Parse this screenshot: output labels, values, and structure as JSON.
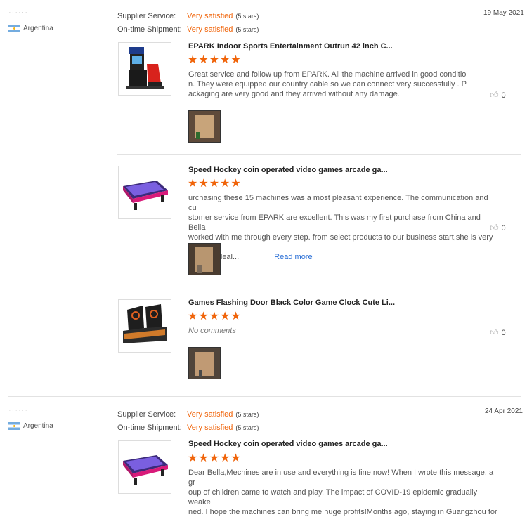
{
  "reviews": [
    {
      "buyer": "······",
      "country": "Argentina",
      "supplier_service_label": "Supplier Service:",
      "supplier_service_value": "Very satisfied",
      "supplier_service_stars": "(5 stars)",
      "shipment_label": "On-time Shipment:",
      "shipment_value": "Very satisfied",
      "shipment_stars": "(5 stars)",
      "date": "19 May 2021",
      "products": [
        {
          "title": "EPARK Indoor Sports Entertainment Outrun 42 inch C...",
          "stars": "★★★★★",
          "comment_lines": [
            "Great service and follow up from EPARK. All the machine arrived in good conditio",
            "n. They were equipped our country cable so we can connect very successfully . P",
            "ackaging are very good and they arrived without any damage."
          ],
          "likes": "0"
        },
        {
          "title": "Speed Hockey coin operated video games arcade ga...",
          "stars": "★★★★★",
          "comment_lines": [
            "urchasing these 15 machines was a most pleasant experience.  The communication and cu",
            "stomer service from EPARK are excellent.  This was my first purchase from China and Bella",
            "worked with me through every step. from select products to our business start,she is very p",
            "atient to deal..."
          ],
          "read_more": "Read more",
          "likes": "0"
        },
        {
          "title": "Games Flashing Door Black Color Game Clock Cute Li...",
          "stars": "★★★★★",
          "no_comments": "No comments",
          "likes": "0"
        }
      ]
    },
    {
      "buyer": "······",
      "country": "Argentina",
      "supplier_service_label": "Supplier Service:",
      "supplier_service_value": "Very satisfied",
      "supplier_service_stars": "(5 stars)",
      "shipment_label": "On-time Shipment:",
      "shipment_value": "Very satisfied",
      "shipment_stars": "(5 stars)",
      "date": "24 Apr 2021",
      "products": [
        {
          "title": "Speed Hockey coin operated video games arcade ga...",
          "stars": "★★★★★",
          "comment_lines": [
            "Dear Bella,Mechines are in use and everything is fine now!  When I wrote this message, a gr",
            "oup of children came to watch and play. The impact of COVID-19 epidemic gradually weake",
            "ned. I hope the machines can bring me huge profits!Months ago, staying in Guangzhou for"
          ]
        }
      ]
    }
  ]
}
